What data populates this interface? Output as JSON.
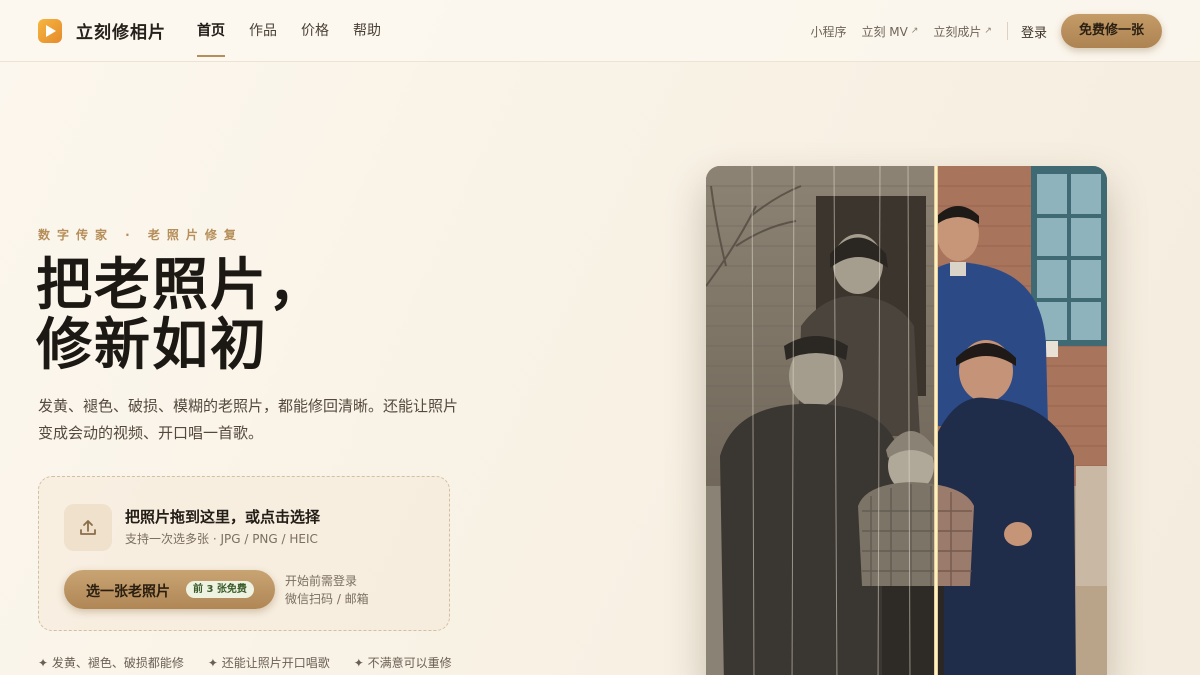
{
  "brand": {
    "name": "立刻修相片",
    "logo_icon": "play-logo-icon"
  },
  "nav": {
    "items": [
      {
        "label": "首页",
        "active": true
      },
      {
        "label": "作品",
        "active": false
      },
      {
        "label": "价格",
        "active": false
      },
      {
        "label": "帮助",
        "active": false
      }
    ]
  },
  "right_nav": {
    "links": [
      {
        "label": "小程序",
        "external": false
      },
      {
        "label": "立刻 MV",
        "external": true
      },
      {
        "label": "立刻成片",
        "external": true
      }
    ],
    "external_arrow": "↗",
    "login_label": "登录",
    "cta_label": "免费修一张"
  },
  "hero": {
    "eyebrow": "数字传家 · 老照片修复",
    "headline_line1": "把老照片，",
    "headline_line2": "修新如初",
    "subtitle": "发黄、褪色、破损、模糊的老照片，都能修回清晰。还能让照片变成会动的视频、开口唱一首歌。"
  },
  "upload": {
    "icon": "upload-icon",
    "title": "把照片拖到这里，或点击选择",
    "hint": "支持一次选多张 · JPG / PNG / HEIC",
    "button_label": "选一张老照片",
    "badge": "前 3 张免费",
    "note_line1": "开始前需登录",
    "note_line2": "微信扫码 / 邮箱"
  },
  "features": [
    "✦ 发黄、褪色、破损都能修",
    "✦ 还能让照片开口唱歌",
    "✦ 不满意可以重修"
  ],
  "colors": {
    "accent": "#b78e5b",
    "cta": "#bb9261",
    "background": "#f8f1e4",
    "badge_text": "#3b5a2a"
  }
}
